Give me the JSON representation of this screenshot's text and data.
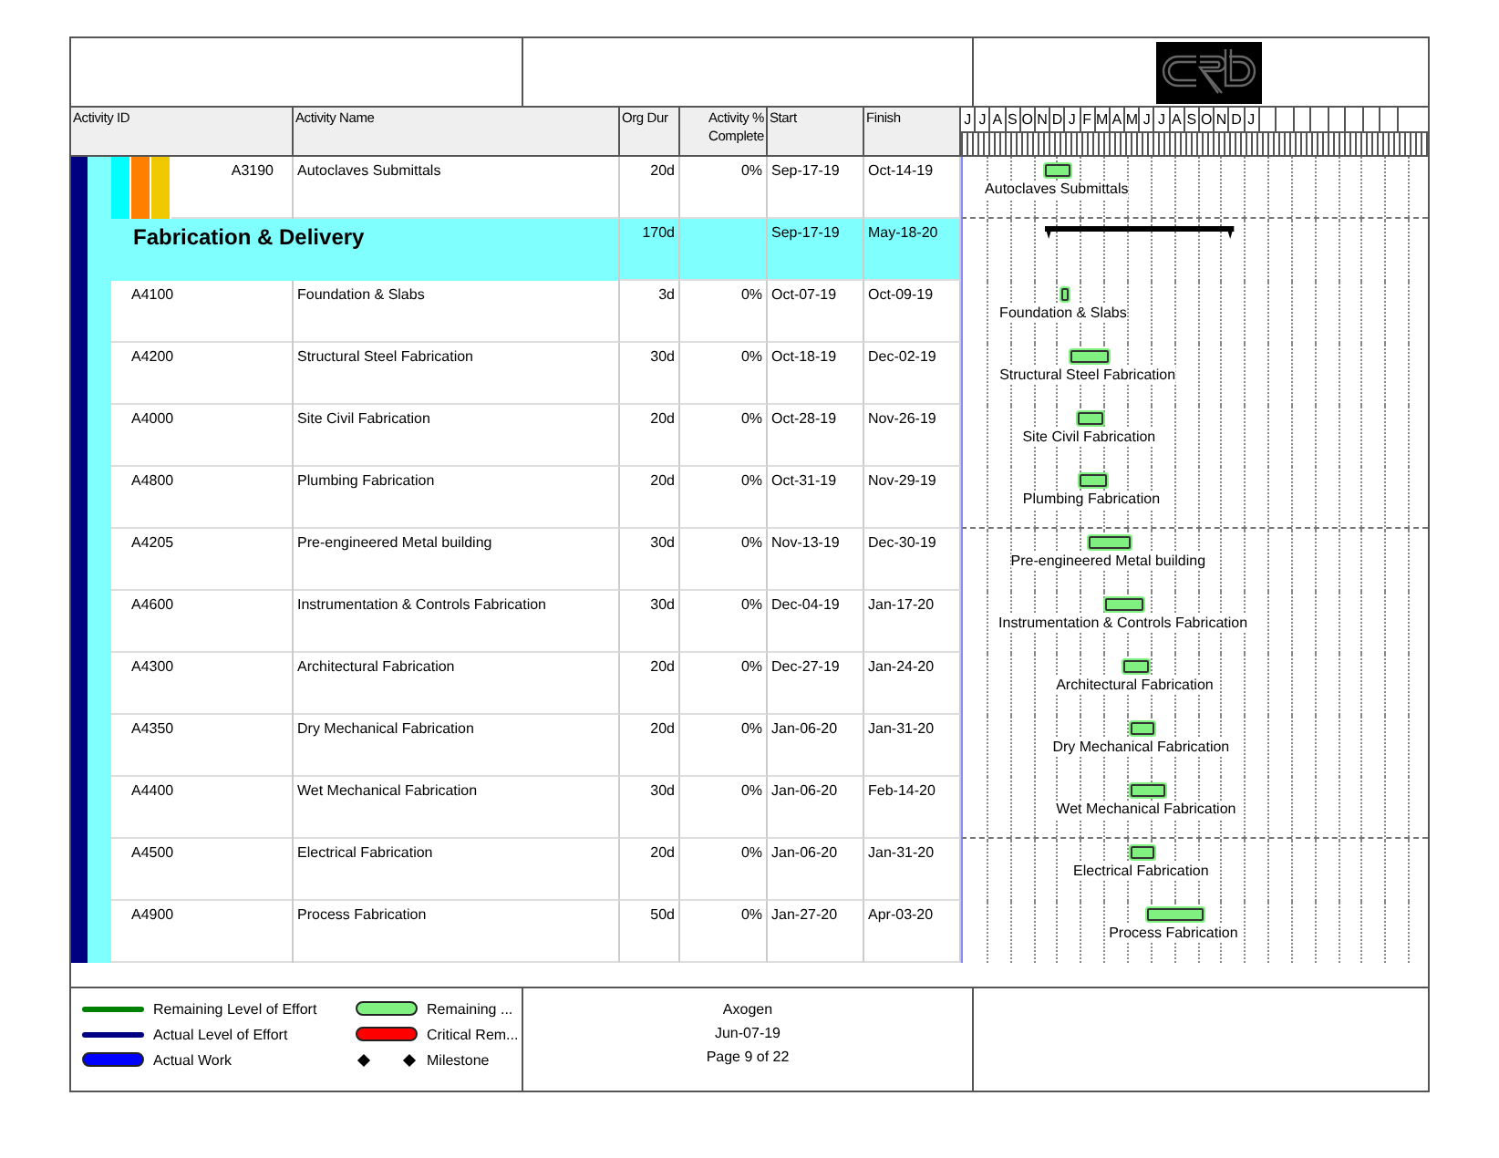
{
  "columns": [
    "Activity ID",
    "Activity Name",
    "Org Dur",
    "Activity % Complete",
    "Start",
    "Finish"
  ],
  "timescale": {
    "months": [
      "J",
      "J",
      "A",
      "S",
      "O",
      "N",
      "D",
      "J",
      "F",
      "M",
      "A",
      "M",
      "J",
      "J",
      "A",
      "S",
      "O",
      "N",
      "D",
      "J"
    ]
  },
  "rows": [
    {
      "kind": "activity",
      "id": "A3190",
      "name": "Autoclaves Submittals",
      "dur": "20d",
      "pct": "0%",
      "start": "Sep-17-19",
      "finish": "Oct-14-19",
      "bar_label": "Autoclaves Submittals",
      "bands": [
        {
          "color": "#00ffff"
        },
        {
          "color": "#ff8000"
        },
        {
          "color": "#f0c800"
        }
      ]
    },
    {
      "kind": "wbs",
      "name": "Fabrication & Delivery",
      "dur": "170d",
      "start": "Sep-17-19",
      "finish": "May-18-20"
    },
    {
      "kind": "activity",
      "id": "A4100",
      "name": "Foundation & Slabs",
      "dur": "3d",
      "pct": "0%",
      "start": "Oct-07-19",
      "finish": "Oct-09-19",
      "bar_label": "Foundation & Slabs"
    },
    {
      "kind": "activity",
      "id": "A4200",
      "name": "Structural Steel Fabrication",
      "dur": "30d",
      "pct": "0%",
      "start": "Oct-18-19",
      "finish": "Dec-02-19",
      "bar_label": "Structural Steel Fabrication"
    },
    {
      "kind": "activity",
      "id": "A4000",
      "name": "Site Civil Fabrication",
      "dur": "20d",
      "pct": "0%",
      "start": "Oct-28-19",
      "finish": "Nov-26-19",
      "bar_label": "Site Civil Fabrication"
    },
    {
      "kind": "activity",
      "id": "A4800",
      "name": "Plumbing Fabrication",
      "dur": "20d",
      "pct": "0%",
      "start": "Oct-31-19",
      "finish": "Nov-29-19",
      "bar_label": "Plumbing Fabrication"
    },
    {
      "kind": "activity",
      "id": "A4205",
      "name": "Pre-engineered Metal building",
      "dur": "30d",
      "pct": "0%",
      "start": "Nov-13-19",
      "finish": "Dec-30-19",
      "bar_label": "Pre-engineered Metal building"
    },
    {
      "kind": "activity",
      "id": "A4600",
      "name": "Instrumentation & Controls Fabrication",
      "dur": "30d",
      "pct": "0%",
      "start": "Dec-04-19",
      "finish": "Jan-17-20",
      "bar_label": "Instrumentation & Controls Fabrication"
    },
    {
      "kind": "activity",
      "id": "A4300",
      "name": "Architectural Fabrication",
      "dur": "20d",
      "pct": "0%",
      "start": "Dec-27-19",
      "finish": "Jan-24-20",
      "bar_label": "Architectural Fabrication"
    },
    {
      "kind": "activity",
      "id": "A4350",
      "name": "Dry Mechanical Fabrication",
      "dur": "20d",
      "pct": "0%",
      "start": "Jan-06-20",
      "finish": "Jan-31-20",
      "bar_label": "Dry Mechanical Fabrication"
    },
    {
      "kind": "activity",
      "id": "A4400",
      "name": "Wet Mechanical Fabrication",
      "dur": "30d",
      "pct": "0%",
      "start": "Jan-06-20",
      "finish": "Feb-14-20",
      "bar_label": "Wet Mechanical Fabrication"
    },
    {
      "kind": "activity",
      "id": "A4500",
      "name": "Electrical Fabrication",
      "dur": "20d",
      "pct": "0%",
      "start": "Jan-06-20",
      "finish": "Jan-31-20",
      "bar_label": "Electrical Fabrication"
    },
    {
      "kind": "activity",
      "id": "A4900",
      "name": "Process Fabrication",
      "dur": "50d",
      "pct": "0%",
      "start": "Jan-27-20",
      "finish": "Apr-03-20",
      "bar_label": "Process Fabrication"
    }
  ],
  "legend": [
    {
      "kind": "loe-remaining",
      "label": "Remaining Level of Effort"
    },
    {
      "kind": "bar-remaining",
      "label": "Remaining ..."
    },
    {
      "kind": "loe-actual",
      "label": "Actual Level of Effort"
    },
    {
      "kind": "bar-critical",
      "label": "Critical Rem..."
    },
    {
      "kind": "actual-work",
      "label": "Actual Work"
    },
    {
      "kind": "milestone",
      "label": "Milestone"
    }
  ],
  "footer": {
    "project": "Axogen",
    "date": "Jun-07-19",
    "page": "Page 9 of 22"
  }
}
